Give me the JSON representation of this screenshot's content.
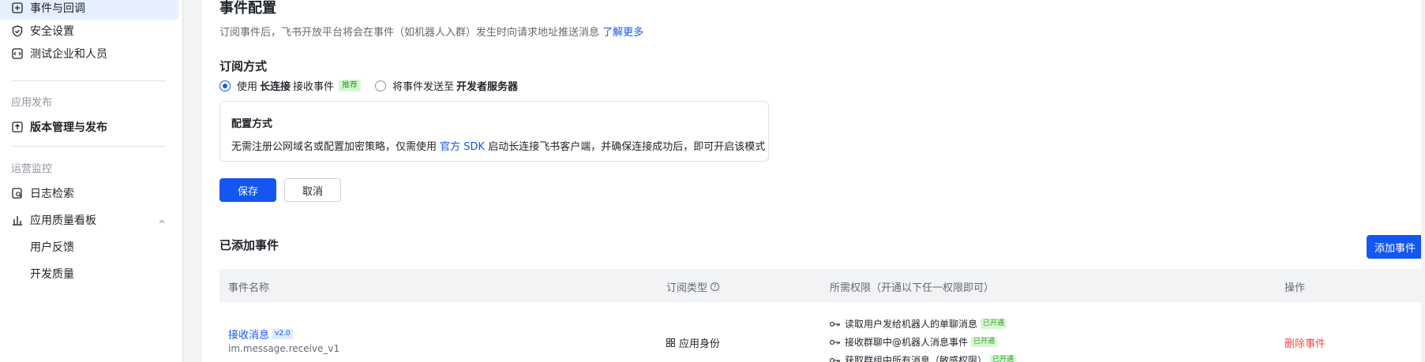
{
  "sidebar": {
    "items": [
      {
        "label": "事件与回调",
        "icon": "event-icon"
      },
      {
        "label": "安全设置",
        "icon": "shield-icon"
      },
      {
        "label": "测试企业和人员",
        "icon": "code-icon"
      }
    ],
    "group_release": "应用发布",
    "release_item": "版本管理与发布",
    "group_ops": "运营监控",
    "ops_items": [
      {
        "label": "日志检索"
      },
      {
        "label": "应用质量看板"
      }
    ],
    "sub_items": [
      "用户反馈",
      "开发质量"
    ]
  },
  "main": {
    "title": "事件配置",
    "desc": "订阅事件后，飞书开放平台将会在事件（如机器人入群）发生时向请求地址推送消息",
    "desc_link": "了解更多",
    "subscribe_title": "订阅方式",
    "opt1_pre": "使用",
    "opt1_bold": "长连接",
    "opt1_post": "接收事件",
    "opt1_tag": "推荐",
    "opt2_pre": "将事件发送至",
    "opt2_bold": "开发者服务器",
    "config_title": "配置方式",
    "config_pre": "无需注册公网域名或配置加密策略，仅需使用",
    "config_link": "官方 SDK",
    "config_post": "启动长连接飞书客户端，并确保连接成功后，即可开启该模式",
    "save": "保存",
    "cancel": "取消",
    "added_title": "已添加事件",
    "add_button": "添加事件",
    "columns": [
      "事件名称",
      "订阅类型",
      "所需权限（开通以下任一权限即可）",
      "操作"
    ],
    "row": {
      "name": "接收消息",
      "version": "v2.0",
      "id": "im.message.receive_v1",
      "type": "应用身份",
      "perms": [
        {
          "label": "读取用户发给机器人的单聊消息",
          "status": "已开通"
        },
        {
          "label": "接收群聊中@机器人消息事件",
          "status": "已开通"
        },
        {
          "label": "获取群组中所有消息（敏感权限）",
          "status": "已开通"
        }
      ],
      "action": "删除事件"
    }
  },
  "colors": {
    "accent": "#1456f0",
    "danger": "#f54a45",
    "success": "#2ea121"
  }
}
